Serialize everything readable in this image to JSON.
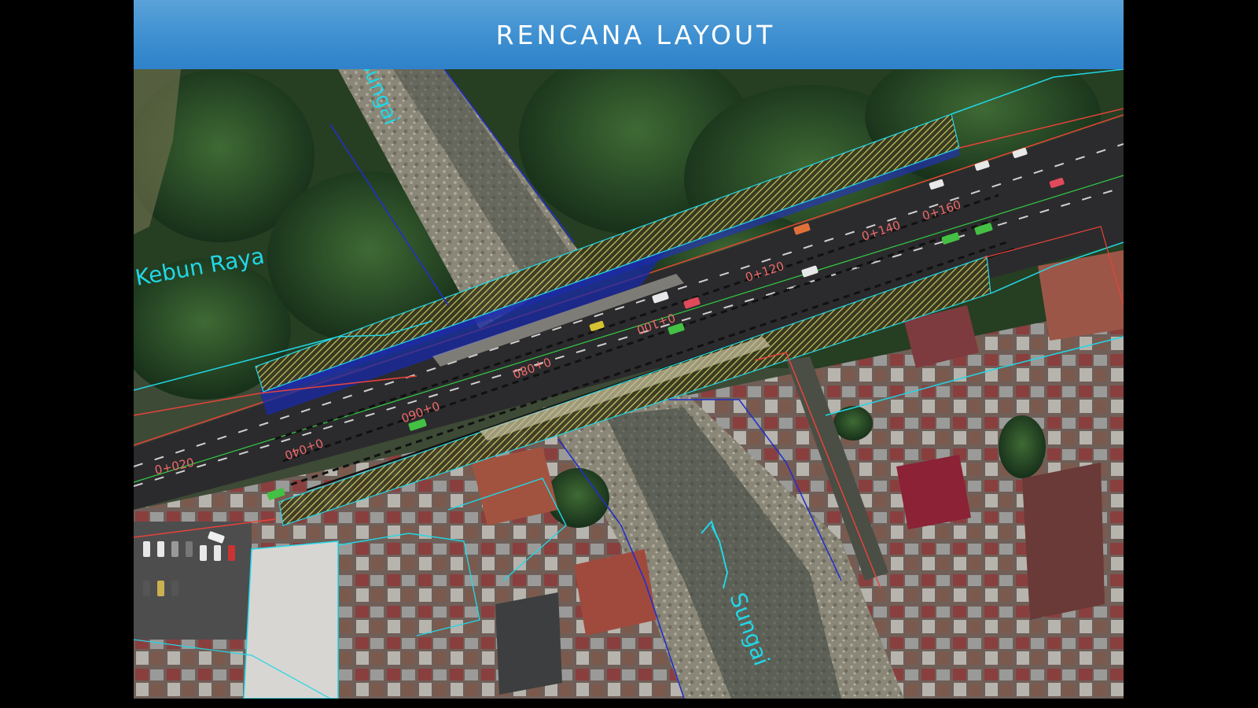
{
  "slide": {
    "title": "RENCANA LAYOUT"
  },
  "map": {
    "place_labels": {
      "kebun_raya": "Kebun Raya",
      "sungai_north": "Sungai",
      "sungai_south": "Sungai"
    },
    "chainage_labels": [
      "0+020",
      "0+040",
      "0+060",
      "0+080",
      "0+100",
      "0+120",
      "0+140",
      "0+160"
    ],
    "colors": {
      "header": "#3d8fd1",
      "cad_cyan": "#22d6e6",
      "cad_red": "#e8433a",
      "cad_blue": "#2330c8",
      "cad_green": "#33cc44",
      "hatch_yellow": "#d9d36a",
      "road": "#2b2b2d",
      "chainage_text": "#f06a6a"
    },
    "icons": [
      "car-icon",
      "tree-icon",
      "roof-icon"
    ]
  }
}
